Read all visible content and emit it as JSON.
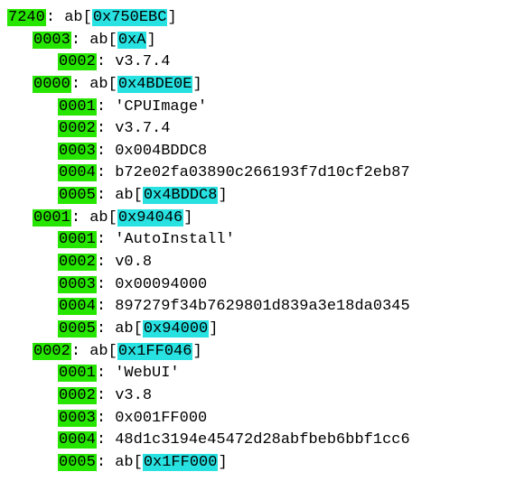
{
  "root": {
    "key": "7240",
    "suffix": ": ab[",
    "addr": "0x750EBC",
    "close": "]"
  },
  "groups": [
    {
      "header": {
        "key": "0003",
        "suffix": ": ab[",
        "addr": "0xA",
        "close": "]"
      },
      "children": [
        {
          "key": "0002",
          "suffix": ": v3.7.4"
        }
      ]
    },
    {
      "header": {
        "key": "0000",
        "suffix": ": ab[",
        "addr": "0x4BDE0E",
        "close": "]"
      },
      "children": [
        {
          "key": "0001",
          "suffix": ": 'CPUImage'"
        },
        {
          "key": "0002",
          "suffix": ": v3.7.4"
        },
        {
          "key": "0003",
          "suffix": ": 0x004BDDC8"
        },
        {
          "key": "0004",
          "suffix": ": b72e02fa03890c266193f7d10cf2eb87"
        },
        {
          "key": "0005",
          "suffix": ": ab[",
          "addr": "0x4BDDC8",
          "close": "]"
        }
      ]
    },
    {
      "header": {
        "key": "0001",
        "suffix": ": ab[",
        "addr": "0x94046",
        "close": "]"
      },
      "children": [
        {
          "key": "0001",
          "suffix": ": 'AutoInstall'"
        },
        {
          "key": "0002",
          "suffix": ": v0.8"
        },
        {
          "key": "0003",
          "suffix": ": 0x00094000"
        },
        {
          "key": "0004",
          "suffix": ": 897279f34b7629801d839a3e18da0345"
        },
        {
          "key": "0005",
          "suffix": ": ab[",
          "addr": "0x94000",
          "close": "]"
        }
      ]
    },
    {
      "header": {
        "key": "0002",
        "suffix": ": ab[",
        "addr": "0x1FF046",
        "close": "]"
      },
      "children": [
        {
          "key": "0001",
          "suffix": ": 'WebUI'"
        },
        {
          "key": "0002",
          "suffix": ": v3.8"
        },
        {
          "key": "0003",
          "suffix": ": 0x001FF000"
        },
        {
          "key": "0004",
          "suffix": ": 48d1c3194e45472d28abfbeb6bbf1cc6"
        },
        {
          "key": "0005",
          "suffix": ": ab[",
          "addr": "0x1FF000",
          "close": "]"
        }
      ]
    }
  ]
}
